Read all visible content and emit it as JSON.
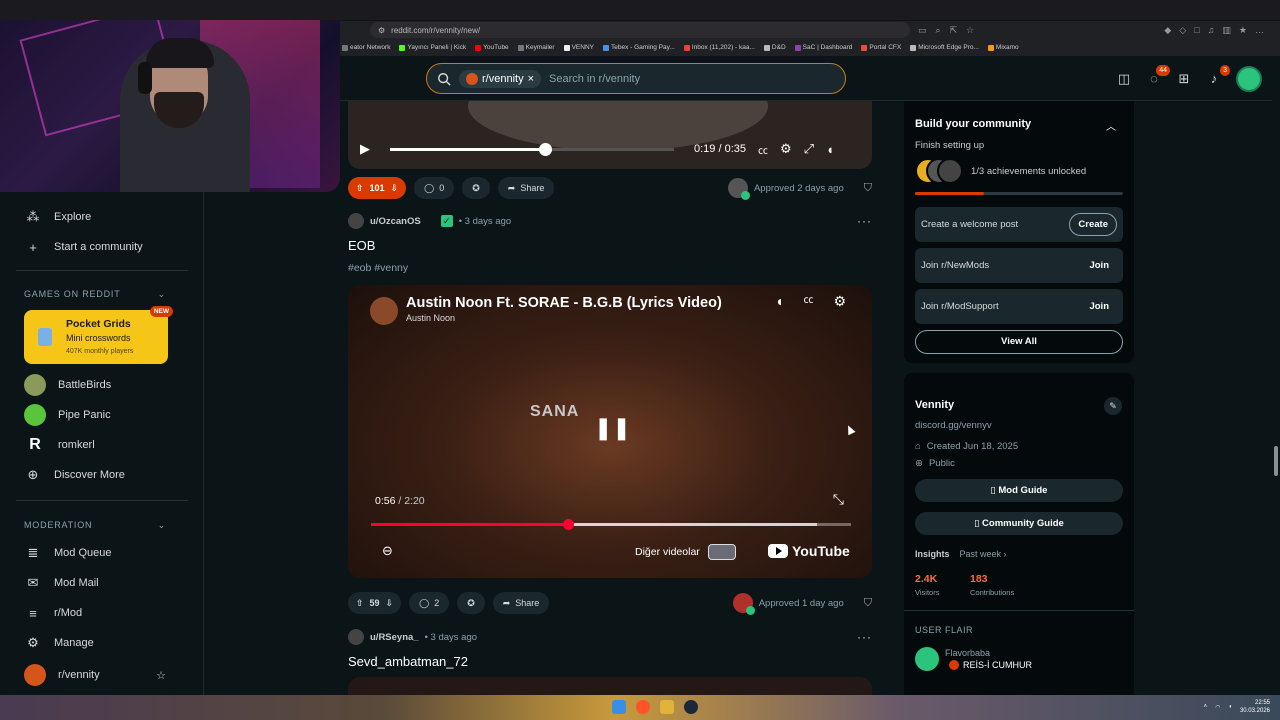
{
  "browser": {
    "url": "reddit.com/r/vennity/new/",
    "bookmarks": [
      "eator Network",
      "Yayıncı Paneli | Kick",
      "YouTube",
      "Keymailer",
      "VENNY",
      "Tebex - Gaming Pay...",
      "Inbox (11,202) - kaa...",
      "D&D",
      "SaC | Dashboard",
      "Portal CFX",
      "Microsoft Edge Pro...",
      "Mixamo"
    ]
  },
  "header": {
    "community_chip": "r/vennity",
    "search_placeholder": "Search in r/vennity",
    "chat_badge": "44",
    "notif_badge": "3"
  },
  "sidebar": {
    "explore": "Explore",
    "start_community": "Start a community",
    "games_section": "GAMES ON REDDIT",
    "featured_game": {
      "title": "Pocket Grids",
      "subtitle": "Mini crosswords",
      "players": "407K monthly players",
      "badge": "NEW"
    },
    "games": [
      "BattleBirds",
      "Pipe Panic",
      "romkerl",
      "Discover More"
    ],
    "moderation_section": "MODERATION",
    "mod_items": [
      "Mod Queue",
      "Mod Mail",
      "r/Mod",
      "Manage",
      "r/vennity"
    ]
  },
  "post1": {
    "time": "0:19 / 0:35",
    "upvotes": "101",
    "comments": "0",
    "share": "Share",
    "approved": "Approved 2 days ago"
  },
  "post2": {
    "author": "u/OzcanOS",
    "age": "• 3 days ago",
    "title": "EOB",
    "tags": "#eob #venny",
    "video": {
      "title": "Austin Noon Ft. SORAE - B.G.B (Lyrics Video)",
      "channel": "Austin Noon",
      "overlay_text": "SANA",
      "current_time": "0:56",
      "duration": "/ 2:20",
      "progress": 0.41,
      "buffered": 0.93,
      "more_videos": "Diğer videolar",
      "logo": "YouTube"
    },
    "upvotes": "59",
    "comments": "2",
    "share": "Share",
    "approved": "Approved 1 day ago"
  },
  "post3": {
    "author": "u/RSeyna_",
    "age": "• 3 days ago",
    "title": "Sevd_ambatman_72"
  },
  "build": {
    "title": "Build your community",
    "subtitle": "Finish setting up",
    "achievements": "1/3 achievements unlocked",
    "achievement_progress": 0.33,
    "tasks": [
      {
        "label": "Create a welcome post",
        "action": "Create"
      },
      {
        "label": "Join r/NewMods",
        "action": "Join"
      },
      {
        "label": "Join r/ModSupport",
        "action": "Join"
      }
    ],
    "view_all": "View All"
  },
  "about": {
    "name": "Vennity",
    "link": "discord.gg/vennyv",
    "created": "Created Jun 18, 2025",
    "visibility": "Public",
    "mod_guide": "Mod Guide",
    "community_guide": "Community Guide",
    "insights_label": "Insights",
    "insights_period": "Past week ›",
    "visitors_value": "2.4K",
    "visitors_label": "Visitors",
    "contributions_value": "183",
    "contributions_label": "Contributions"
  },
  "flair": {
    "header": "USER FLAIR",
    "name": "Flavorbaba",
    "text": "REİS-İ CUMHUR"
  },
  "taskbar": {
    "time": "22:55",
    "date": "30.03.2026"
  },
  "colors": {
    "accent": "#d93a00",
    "background": "#0b1416",
    "panel": "#1a282d",
    "yt_red": "#ff0033"
  }
}
